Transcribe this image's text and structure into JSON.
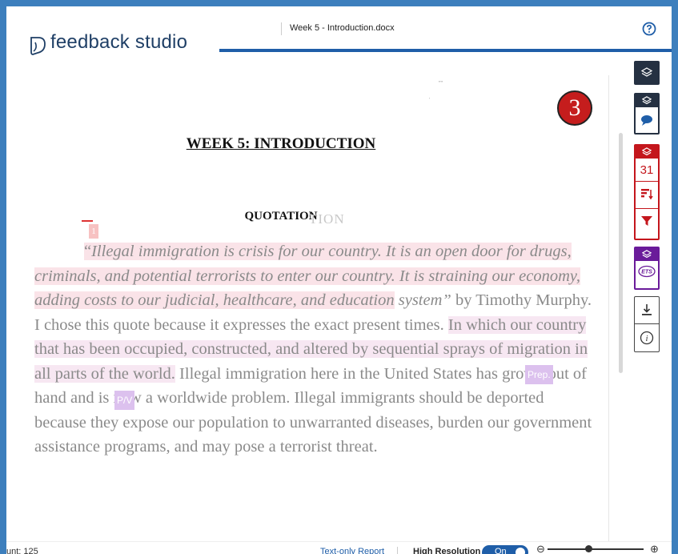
{
  "header": {
    "brand": "feedback studio",
    "doc_title": "Week 5 - Introduction.docx",
    "help_icon": "help-circle-icon"
  },
  "document": {
    "faded_mark_1": "''''",
    "faded_mark_2": "'",
    "badge_number": "3",
    "heading": "WEEK 5: INTRODUCTION",
    "subheading": "QUOTATION",
    "subheading_ghost": "TION",
    "match_number": "1",
    "paragraph": {
      "open_quote": "“",
      "quote_part1": "Illegal immigration is crisis for our country. It is an open door for drugs, criminals, and potential terrorists to enter our country. It is straining our economy, adding costs to our judicial, healthcare, and education",
      "quote_part2": " system”",
      "attribution": " by Timothy Murphy. I chose this quote because it expresses the exact present times. ",
      "hl_sentence": "In which our country that has been occupied, constructed, and altered by sequential sprays of migration in all parts of the world.",
      "rest": " Illegal immigration here in the United States has grown out of hand and is now a worldwide problem. Illegal immigrants should be deported because they expose our population to unwarranted diseases, burden our government assistance programs, and may pose a terrorist threat."
    },
    "tags": {
      "prep": "Prep.",
      "pv": "P/V"
    }
  },
  "toolbar": {
    "layers_icon": "layers-icon",
    "comment_icon": "comment-icon",
    "similarity_count": "31",
    "sort_icon": "sort-icon",
    "filter_icon": "filter-icon",
    "ets_icon": "ets-icon",
    "download_icon": "download-icon",
    "info_icon": "info-icon",
    "colors": {
      "dark": "#253142",
      "red": "#c4161c",
      "purple": "#6a1b9a",
      "blue": "#1f5ea8"
    }
  },
  "status_bar": {
    "word_count": "unt: 125",
    "text_only_report": "Text-only Report",
    "high_resolution": "High Resolution",
    "toggle_state": "On",
    "zoom_out": "⊖",
    "zoom_in": "⊕"
  }
}
